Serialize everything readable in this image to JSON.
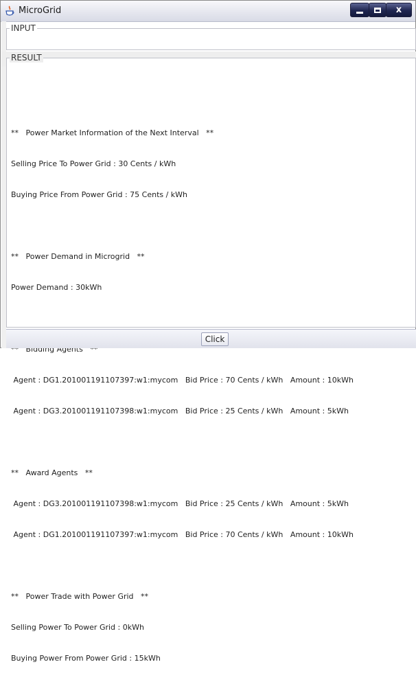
{
  "window": {
    "title": "MicroGrid",
    "icon": "java-cup-icon",
    "controls": [
      "minimize-icon",
      "maximize-icon",
      "close-icon"
    ],
    "close_label": "x"
  },
  "input_panel": {
    "label": "INPUT",
    "value": ""
  },
  "result_panel": {
    "label": "RESULT",
    "lines": [
      "",
      "**   Power Market Information of the Next Interval   **",
      "Selling Price To Power Grid : 30 Cents / kWh",
      "Buying Price From Power Grid : 75 Cents / kWh",
      "",
      "**   Power Demand in Microgrid   **",
      "Power Demand : 30kWh",
      "",
      "**   Bidding Agents   **",
      " Agent : DG1.201001191107397:w1:mycom   Bid Price : 70 Cents / kWh   Amount : 10kWh",
      " Agent : DG3.201001191107398:w1:mycom   Bid Price : 25 Cents / kWh   Amount : 5kWh",
      "",
      "**   Award Agents   **",
      " Agent : DG3.201001191107398:w1:mycom   Bid Price : 25 Cents / kWh   Amount : 5kWh",
      " Agent : DG1.201001191107397:w1:mycom   Bid Price : 70 Cents / kWh   Amount : 10kWh",
      "",
      "**   Power Trade with Power Grid   **",
      "Selling Power To Power Grid : 0kWh",
      "Buying Power From Power Grid : 15kWh"
    ]
  },
  "button": {
    "label": "Click"
  },
  "colors": {
    "titlebar_button": "#1f2650",
    "panel_border": "#bfc0c8"
  }
}
